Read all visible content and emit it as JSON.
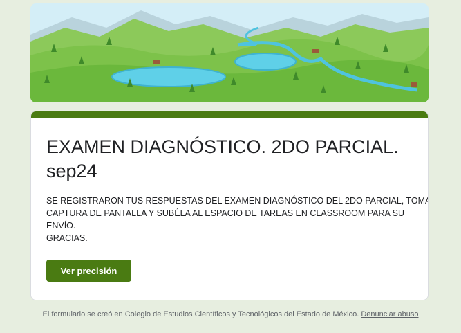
{
  "form": {
    "title": "EXAMEN DIAGNÓSTICO. 2DO PARCIAL. sep24",
    "description_lines": [
      "SE REGISTRARON TUS RESPUESTAS DEL EXAMEN DIAGNÓSTICO DEL 2DO PARCIAL, TOMA",
      "CAPTURA DE PANTALLA Y SUBÉLA AL ESPACIO DE TAREAS EN CLASSROOM PARA SU",
      "ENVÍO.",
      "GRACIAS."
    ],
    "button_label": "Ver precisión"
  },
  "footer": {
    "text": "El formulario se creó en Colegio de Estudios Científicos y Tecnológicos del Estado de México. ",
    "link_label": "Denunciar abuso"
  },
  "colors": {
    "accent": "#4a7b12",
    "page_background": "#e7eee0",
    "card_background": "#ffffff"
  }
}
